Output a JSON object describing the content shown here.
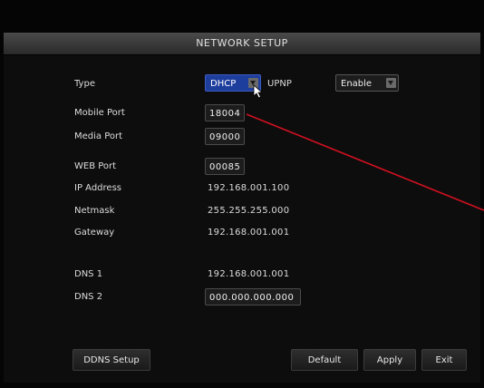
{
  "window": {
    "title": "NETWORK SETUP"
  },
  "fields": {
    "type": {
      "label": "Type",
      "value": "DHCP"
    },
    "upnp": {
      "label": "UPNP",
      "value": "Enable"
    },
    "mobile_port": {
      "label": "Mobile Port",
      "value": "18004"
    },
    "media_port": {
      "label": "Media Port",
      "value": "09000"
    },
    "web_port": {
      "label": "WEB Port",
      "value": "00085"
    },
    "ip_address": {
      "label": "IP Address",
      "value": "192.168.001.100"
    },
    "netmask": {
      "label": "Netmask",
      "value": "255.255.255.000"
    },
    "gateway": {
      "label": "Gateway",
      "value": "192.168.001.001"
    },
    "dns1": {
      "label": "DNS 1",
      "value": "192.168.001.001"
    },
    "dns2": {
      "label": "DNS 2",
      "value": "000.000.000.000"
    }
  },
  "buttons": {
    "ddns_setup": "DDNS Setup",
    "default": "Default",
    "apply": "Apply",
    "exit": "Exit"
  },
  "colors": {
    "accent": "#1e3e9e",
    "annotation_line": "#d01020"
  }
}
